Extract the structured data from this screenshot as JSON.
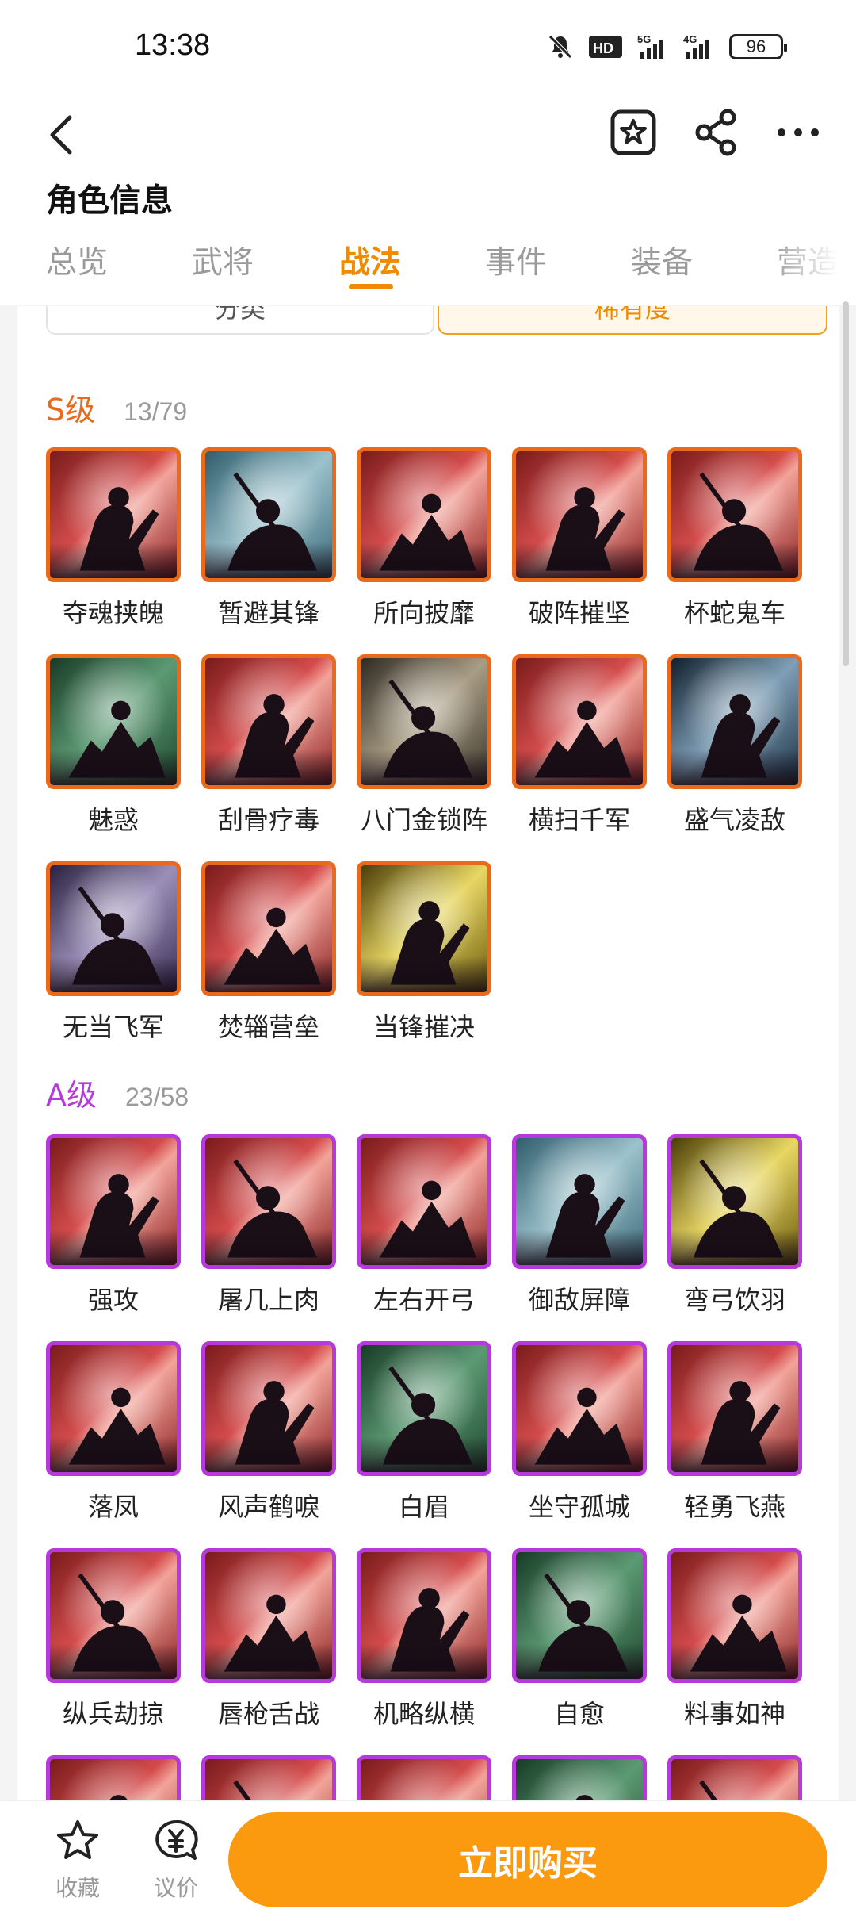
{
  "status": {
    "time": "13:38",
    "battery": "96",
    "hd_label": "HD",
    "net1": "5G",
    "net2": "4G"
  },
  "header": {
    "title": "角色信息",
    "tabs": [
      {
        "label": "总览"
      },
      {
        "label": "武将"
      },
      {
        "label": "战法"
      },
      {
        "label": "事件"
      },
      {
        "label": "装备"
      },
      {
        "label": "营造"
      }
    ],
    "active_tab": "战法"
  },
  "filters": {
    "category": "分类",
    "rarity": "稀有度"
  },
  "sections": [
    {
      "tier": "S级",
      "count": "13/79",
      "accent": "#e96a1c",
      "items": [
        {
          "name": "夺魂挟魄",
          "theme": "red"
        },
        {
          "name": "暂避其锋",
          "theme": "teal"
        },
        {
          "name": "所向披靡",
          "theme": "red"
        },
        {
          "name": "破阵摧坚",
          "theme": "red"
        },
        {
          "name": "杯蛇鬼车",
          "theme": "red"
        },
        {
          "name": "魅惑",
          "theme": "green"
        },
        {
          "name": "刮骨疗毒",
          "theme": "red"
        },
        {
          "name": "八门金锁阵",
          "theme": "sepia"
        },
        {
          "name": "横扫千军",
          "theme": "red"
        },
        {
          "name": "盛气凌敌",
          "theme": "steel"
        },
        {
          "name": "无当飞军",
          "theme": "violet"
        },
        {
          "name": "焚辎营垒",
          "theme": "red"
        },
        {
          "name": "当锋摧决",
          "theme": "gold"
        }
      ]
    },
    {
      "tier": "A级",
      "count": "23/58",
      "accent": "#b63ad9",
      "items": [
        {
          "name": "强攻",
          "theme": "red"
        },
        {
          "name": "屠几上肉",
          "theme": "red"
        },
        {
          "name": "左右开弓",
          "theme": "red"
        },
        {
          "name": "御敌屏障",
          "theme": "teal"
        },
        {
          "name": "弯弓饮羽",
          "theme": "gold"
        },
        {
          "name": "落凤",
          "theme": "red"
        },
        {
          "name": "风声鹤唳",
          "theme": "red"
        },
        {
          "name": "白眉",
          "theme": "green"
        },
        {
          "name": "坐守孤城",
          "theme": "red"
        },
        {
          "name": "轻勇飞燕",
          "theme": "red"
        },
        {
          "name": "纵兵劫掠",
          "theme": "red"
        },
        {
          "name": "唇枪舌战",
          "theme": "red"
        },
        {
          "name": "机略纵横",
          "theme": "red"
        },
        {
          "name": "自愈",
          "theme": "green"
        },
        {
          "name": "料事如神",
          "theme": "red"
        },
        {
          "name": "",
          "theme": "red"
        },
        {
          "name": "",
          "theme": "red"
        },
        {
          "name": "",
          "theme": "red"
        },
        {
          "name": "",
          "theme": "green"
        },
        {
          "name": "",
          "theme": "red"
        }
      ]
    }
  ],
  "bottom_bar": {
    "favorite_label": "收藏",
    "bargain_label": "议价",
    "buy_label": "立即购买"
  },
  "colors": {
    "accent": "#f08a00",
    "buy_button": "#fb9a0e",
    "tier_s": "#e96a1c",
    "tier_a": "#b63ad9"
  }
}
